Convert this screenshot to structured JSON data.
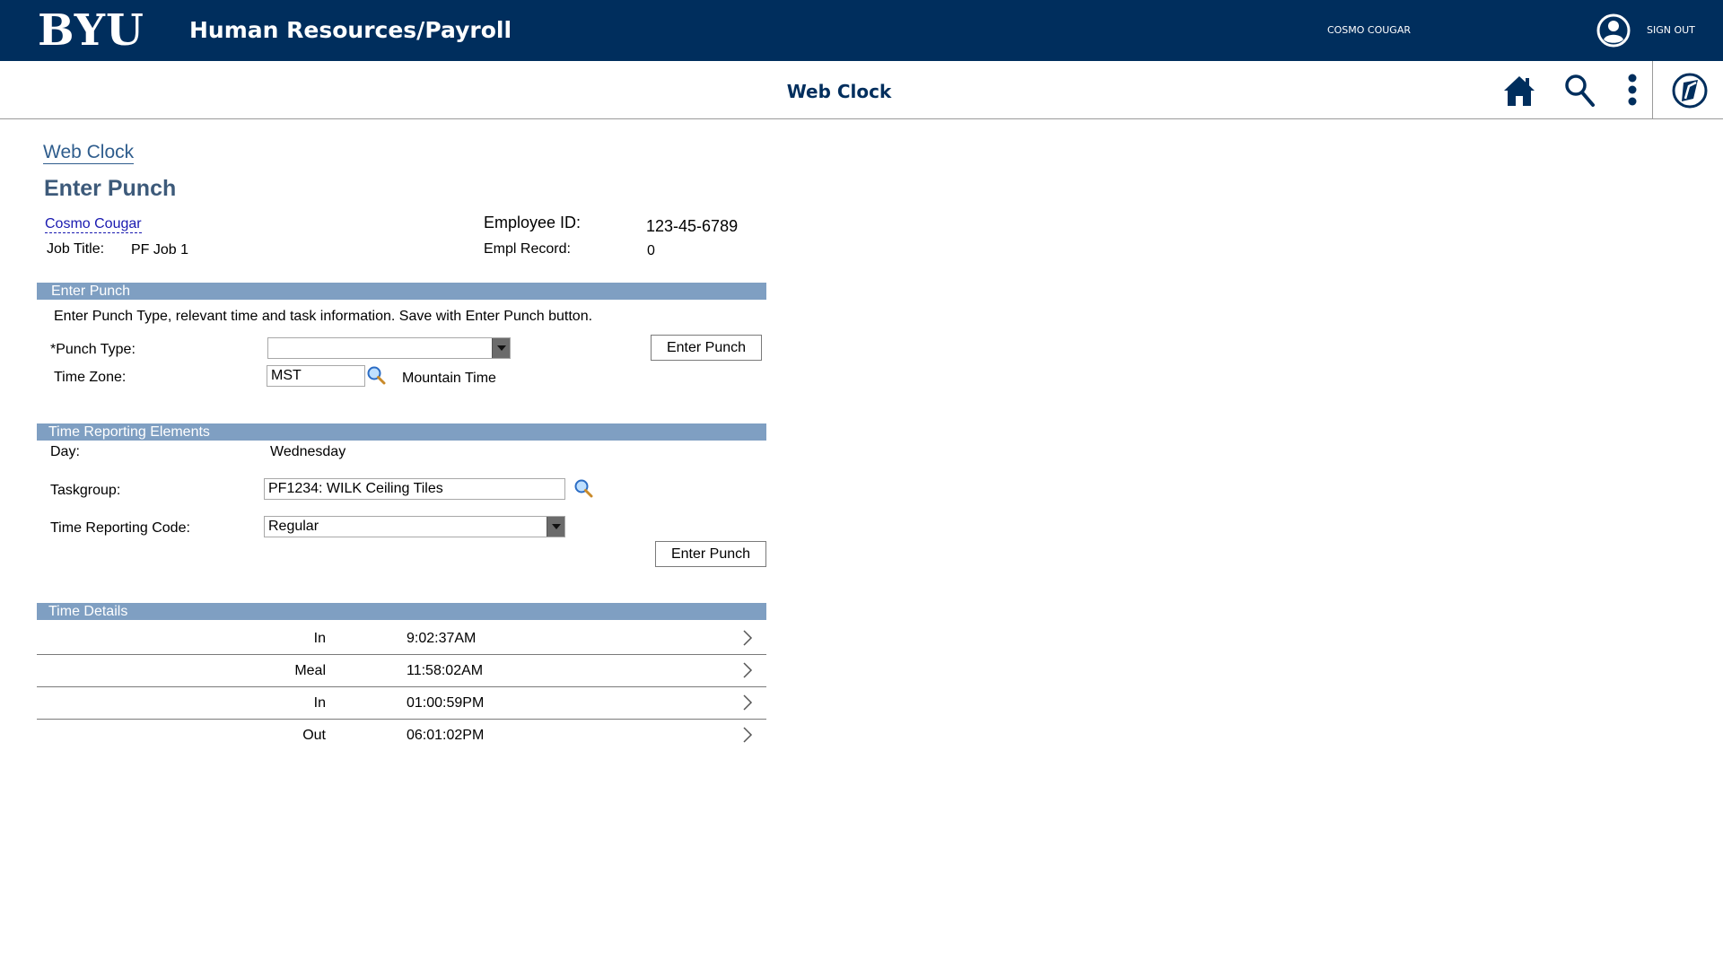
{
  "header": {
    "logo": "BYU",
    "app_title": "Human Resources/Payroll",
    "user_name": "COSMO COUGAR",
    "sign_out": "SIGN OUT"
  },
  "subheader": {
    "title": "Web Clock",
    "icons": [
      "home-icon",
      "search-icon",
      "more-options-icon",
      "navbar-compass-icon"
    ]
  },
  "breadcrumb": "Web Clock",
  "page_title": "Enter Punch",
  "employee": {
    "name": "Cosmo Cougar",
    "job_title_label": "Job Title:",
    "job_title": "PF Job 1",
    "id_label": "Employee ID:",
    "id": "123-45-6789",
    "record_label": "Empl Record:",
    "record": "0"
  },
  "enter_punch_section": {
    "title": "Enter Punch",
    "instructions": "Enter Punch Type, relevant time and task information. Save with Enter Punch button.",
    "punch_type_label": "*Punch Type:",
    "punch_type_value": "",
    "time_zone_label": "Time Zone:",
    "time_zone_value": "MST",
    "time_zone_desc": "Mountain Time",
    "button_label": "Enter Punch"
  },
  "time_reporting_section": {
    "title": "Time Reporting Elements",
    "day_label": "Day:",
    "day_value": "Wednesday",
    "taskgroup_label": "Taskgroup:",
    "taskgroup_value": "PF1234: WILK Ceiling Tiles",
    "trc_label": "Time Reporting Code:",
    "trc_value": "Regular",
    "button_label": "Enter Punch"
  },
  "time_details_section": {
    "title": "Time Details",
    "rows": [
      {
        "type": "In",
        "time": "9:02:37AM"
      },
      {
        "type": "Meal",
        "time": "11:58:02AM"
      },
      {
        "type": "In",
        "time": "01:00:59PM"
      },
      {
        "type": "Out",
        "time": "06:01:02PM"
      }
    ]
  },
  "colors": {
    "banner": "#002e5d",
    "section_bar": "#7f9fc2",
    "link": "#1a1ab0",
    "title": "#3d5a7a"
  }
}
